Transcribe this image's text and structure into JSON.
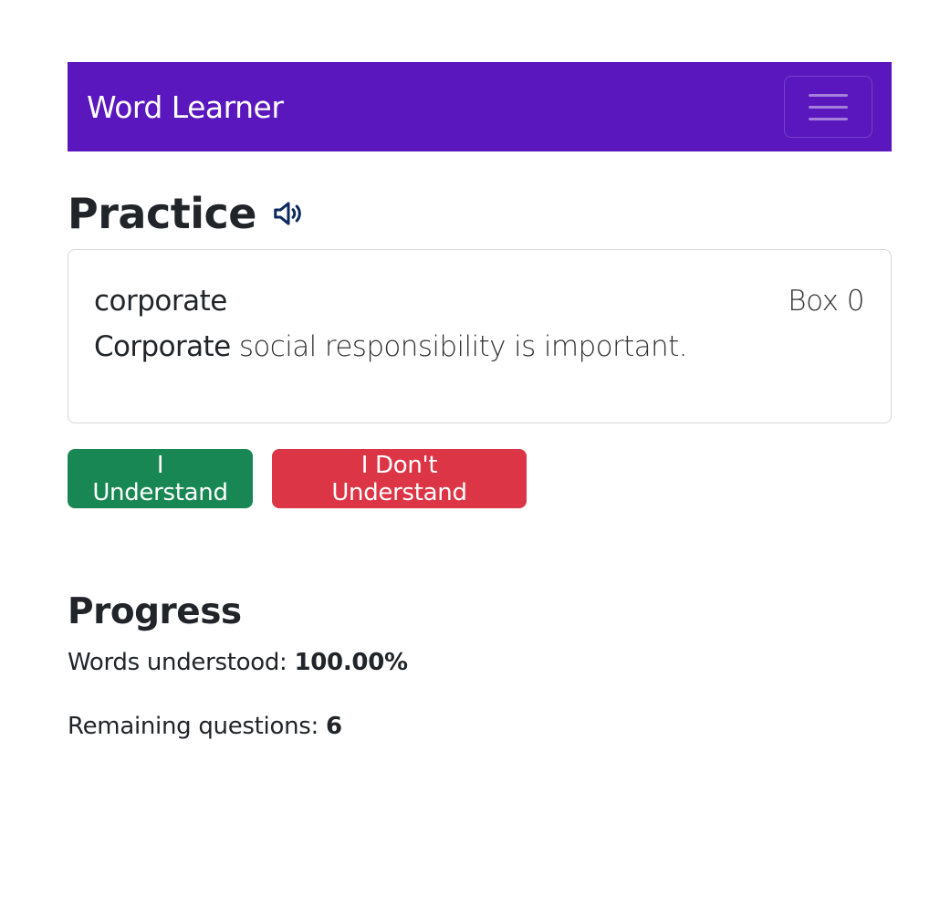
{
  "navbar": {
    "brand": "Word Learner",
    "toggler_icon": "hamburger-menu-icon",
    "color": "#5a17bd"
  },
  "practice": {
    "title": "Practice",
    "speaker_icon": "speaker-icon",
    "card": {
      "word": "corporate",
      "box_label": "Box 0",
      "sentence_highlight": "Corporate",
      "sentence_rest": " social responsibility is important."
    },
    "buttons": {
      "understand": "I Understand",
      "dont_understand": "I Don't Understand",
      "understand_color": "#198754",
      "dont_understand_color": "#dc3545"
    }
  },
  "progress": {
    "title": "Progress",
    "words_understood_label": "Words understood: ",
    "words_understood_value": "100.00%",
    "remaining_label": "Remaining questions: ",
    "remaining_value": "6"
  }
}
